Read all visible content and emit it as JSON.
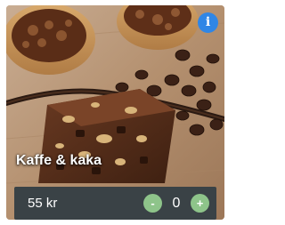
{
  "product": {
    "title": "Kaffe & kaka",
    "price": "55 kr",
    "quantity": "0",
    "image_description": "Chocolate nut slice with vanilla pod and coffee beans"
  },
  "controls": {
    "info_label": "i",
    "decrement_label": "-",
    "increment_label": "+"
  },
  "colors": {
    "info_button": "#2f86e6",
    "qty_button": "#8ec48a",
    "bar_background": "#3a4246"
  },
  "icons": {
    "info": "info-icon",
    "decrement": "minus-icon",
    "increment": "plus-icon"
  }
}
